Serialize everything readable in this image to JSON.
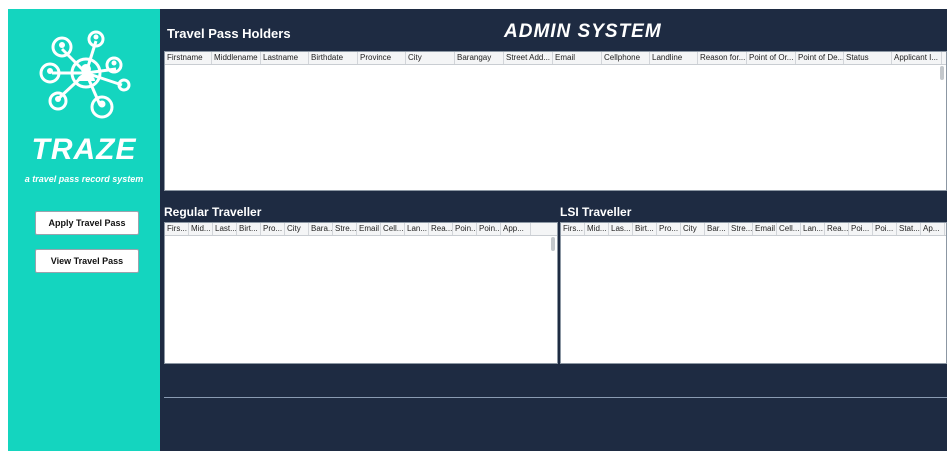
{
  "app": {
    "title": "ADMIN SYSTEM",
    "brand": "TRAZE",
    "tagline": "a travel pass record system"
  },
  "sidebar": {
    "buttons": [
      {
        "label": "Apply Travel Pass"
      },
      {
        "label": "View Travel Pass"
      }
    ]
  },
  "sections": {
    "holders": {
      "title": "Travel Pass Holders",
      "columns": [
        "Firstname",
        "Middlename",
        "Lastname",
        "Birthdate",
        "Province",
        "City",
        "Barangay",
        "Street Add...",
        "Email",
        "Cellphone",
        "Landline",
        "Reason for...",
        "Point of Or...",
        "Point of De...",
        "Status",
        "Applicant I..."
      ]
    },
    "regular": {
      "title": "Regular Traveller",
      "columns": [
        "Firs...",
        "Mid...",
        "Last...",
        "Birt...",
        "Pro...",
        "City",
        "Bara...",
        "Stre...",
        "Email",
        "Cell...",
        "Lan...",
        "Rea...",
        "Poin...",
        "Poin...",
        "App..."
      ]
    },
    "lsi": {
      "title": "LSI Traveller",
      "columns": [
        "Firs...",
        "Mid...",
        "Las...",
        "Birt...",
        "Pro...",
        "City",
        "Bar...",
        "Stre...",
        "Email",
        "Cell...",
        "Lan...",
        "Rea...",
        "Poi...",
        "Poi...",
        "Stat...",
        "Ap..."
      ]
    }
  },
  "colors": {
    "sidebar": "#14d5bf",
    "background": "#1e2b42"
  }
}
